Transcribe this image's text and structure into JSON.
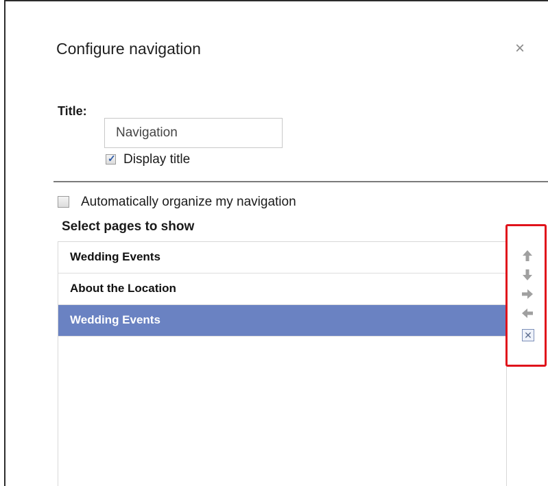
{
  "dialog": {
    "title": "Configure navigation",
    "close_glyph": "×"
  },
  "title_field": {
    "label": "Title:",
    "value": "Navigation"
  },
  "display_title": {
    "label": "Display title",
    "checked": true
  },
  "auto_organize": {
    "label": "Automatically organize my navigation",
    "checked": false
  },
  "pages": {
    "heading": "Select pages to show",
    "items": [
      {
        "label": "Wedding Events",
        "selected": false
      },
      {
        "label": "About the Location",
        "selected": false
      },
      {
        "label": "Wedding Events",
        "selected": true
      }
    ]
  },
  "controls": {
    "up_icon": "arrow-up-icon",
    "down_icon": "arrow-down-icon",
    "right_icon": "arrow-right-icon",
    "left_icon": "arrow-left-icon",
    "remove_icon": "remove-icon",
    "highlight_color": "#e0121b"
  },
  "colors": {
    "selected_row": "#6a82c2"
  }
}
